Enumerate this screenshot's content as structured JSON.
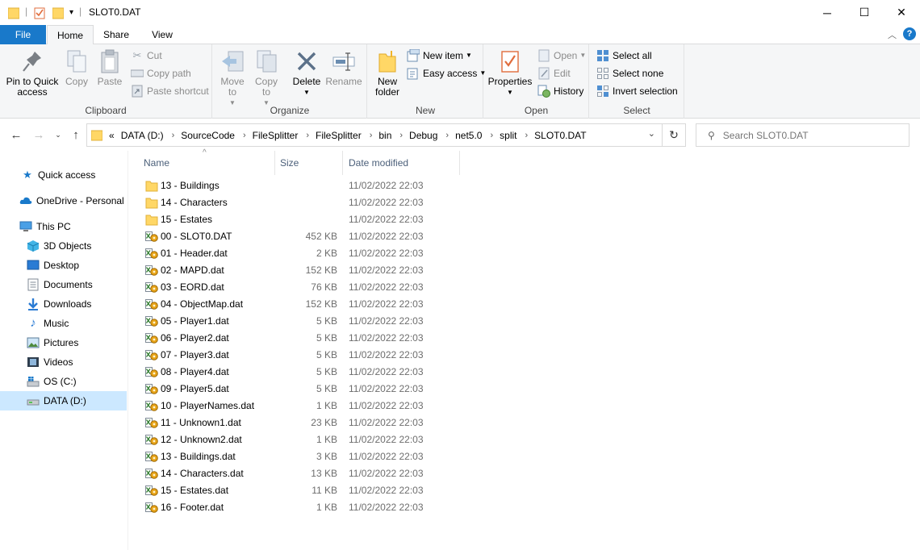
{
  "window": {
    "title": "SLOT0.DAT",
    "controls": {
      "minimize": "─",
      "maximize": "☐",
      "close": "✕"
    }
  },
  "ribbon_tabs": [
    {
      "label": "File"
    },
    {
      "label": "Home"
    },
    {
      "label": "Share"
    },
    {
      "label": "View"
    }
  ],
  "ribbon": {
    "clipboard": {
      "label": "Clipboard",
      "pin": "Pin to Quick access",
      "copy": "Copy",
      "paste": "Paste",
      "cut": "Cut",
      "copy_path": "Copy path",
      "paste_shortcut": "Paste shortcut"
    },
    "organize": {
      "label": "Organize",
      "move_to": "Move to",
      "copy_to": "Copy to",
      "delete": "Delete",
      "rename": "Rename"
    },
    "new": {
      "label": "New",
      "new_folder": "New folder",
      "new_item": "New item",
      "easy_access": "Easy access"
    },
    "open": {
      "label": "Open",
      "properties": "Properties",
      "open": "Open",
      "edit": "Edit",
      "history": "History"
    },
    "select": {
      "label": "Select",
      "select_all": "Select all",
      "select_none": "Select none",
      "invert_selection": "Invert selection"
    }
  },
  "address": {
    "overflow": "«",
    "crumbs": [
      "DATA (D:)",
      "SourceCode",
      "FileSplitter",
      "FileSplitter",
      "bin",
      "Debug",
      "net5.0",
      "split",
      "SLOT0.DAT"
    ]
  },
  "search": {
    "placeholder": "Search SLOT0.DAT"
  },
  "nav": {
    "quick_access": "Quick access",
    "onedrive": "OneDrive - Personal",
    "this_pc": "This PC",
    "items": [
      "3D Objects",
      "Desktop",
      "Documents",
      "Downloads",
      "Music",
      "Pictures",
      "Videos",
      "OS (C:)",
      "DATA (D:)"
    ]
  },
  "columns": {
    "name": "Name",
    "size": "Size",
    "date": "Date modified"
  },
  "files": [
    {
      "name": "13 - Buildings",
      "size": "",
      "date": "11/02/2022 22:03",
      "type": "folder"
    },
    {
      "name": "14 - Characters",
      "size": "",
      "date": "11/02/2022 22:03",
      "type": "folder"
    },
    {
      "name": "15 - Estates",
      "size": "",
      "date": "11/02/2022 22:03",
      "type": "folder"
    },
    {
      "name": "00 - SLOT0.DAT",
      "size": "452 KB",
      "date": "11/02/2022 22:03",
      "type": "file"
    },
    {
      "name": "01 - Header.dat",
      "size": "2 KB",
      "date": "11/02/2022 22:03",
      "type": "file"
    },
    {
      "name": "02 - MAPD.dat",
      "size": "152 KB",
      "date": "11/02/2022 22:03",
      "type": "file"
    },
    {
      "name": "03 - EORD.dat",
      "size": "76 KB",
      "date": "11/02/2022 22:03",
      "type": "file"
    },
    {
      "name": "04 - ObjectMap.dat",
      "size": "152 KB",
      "date": "11/02/2022 22:03",
      "type": "file"
    },
    {
      "name": "05 - Player1.dat",
      "size": "5 KB",
      "date": "11/02/2022 22:03",
      "type": "file"
    },
    {
      "name": "06 - Player2.dat",
      "size": "5 KB",
      "date": "11/02/2022 22:03",
      "type": "file"
    },
    {
      "name": "07 - Player3.dat",
      "size": "5 KB",
      "date": "11/02/2022 22:03",
      "type": "file"
    },
    {
      "name": "08 - Player4.dat",
      "size": "5 KB",
      "date": "11/02/2022 22:03",
      "type": "file"
    },
    {
      "name": "09 - Player5.dat",
      "size": "5 KB",
      "date": "11/02/2022 22:03",
      "type": "file"
    },
    {
      "name": "10 - PlayerNames.dat",
      "size": "1 KB",
      "date": "11/02/2022 22:03",
      "type": "file"
    },
    {
      "name": "11 - Unknown1.dat",
      "size": "23 KB",
      "date": "11/02/2022 22:03",
      "type": "file"
    },
    {
      "name": "12 - Unknown2.dat",
      "size": "1 KB",
      "date": "11/02/2022 22:03",
      "type": "file"
    },
    {
      "name": "13 - Buildings.dat",
      "size": "3 KB",
      "date": "11/02/2022 22:03",
      "type": "file"
    },
    {
      "name": "14 - Characters.dat",
      "size": "13 KB",
      "date": "11/02/2022 22:03",
      "type": "file"
    },
    {
      "name": "15 - Estates.dat",
      "size": "11 KB",
      "date": "11/02/2022 22:03",
      "type": "file"
    },
    {
      "name": "16 - Footer.dat",
      "size": "1 KB",
      "date": "11/02/2022 22:03",
      "type": "file"
    }
  ],
  "colors": {
    "accent": "#1979ca",
    "folder": "#ffd766",
    "selection": "#cce8ff"
  }
}
